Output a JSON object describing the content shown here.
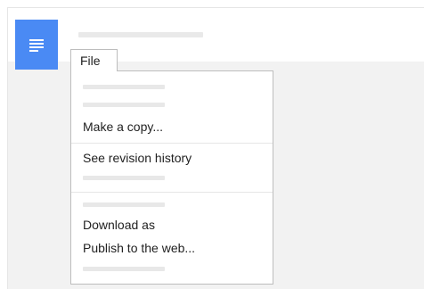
{
  "app": {
    "logo_icon": "docs-menu-icon",
    "accent": "#4a8af4"
  },
  "menubar": {
    "file_label": "File"
  },
  "file_menu": {
    "items": [
      {
        "label": "Make a copy..."
      },
      {
        "label": "See revision history"
      },
      {
        "label": "Download as"
      },
      {
        "label": "Publish to the web..."
      }
    ]
  }
}
